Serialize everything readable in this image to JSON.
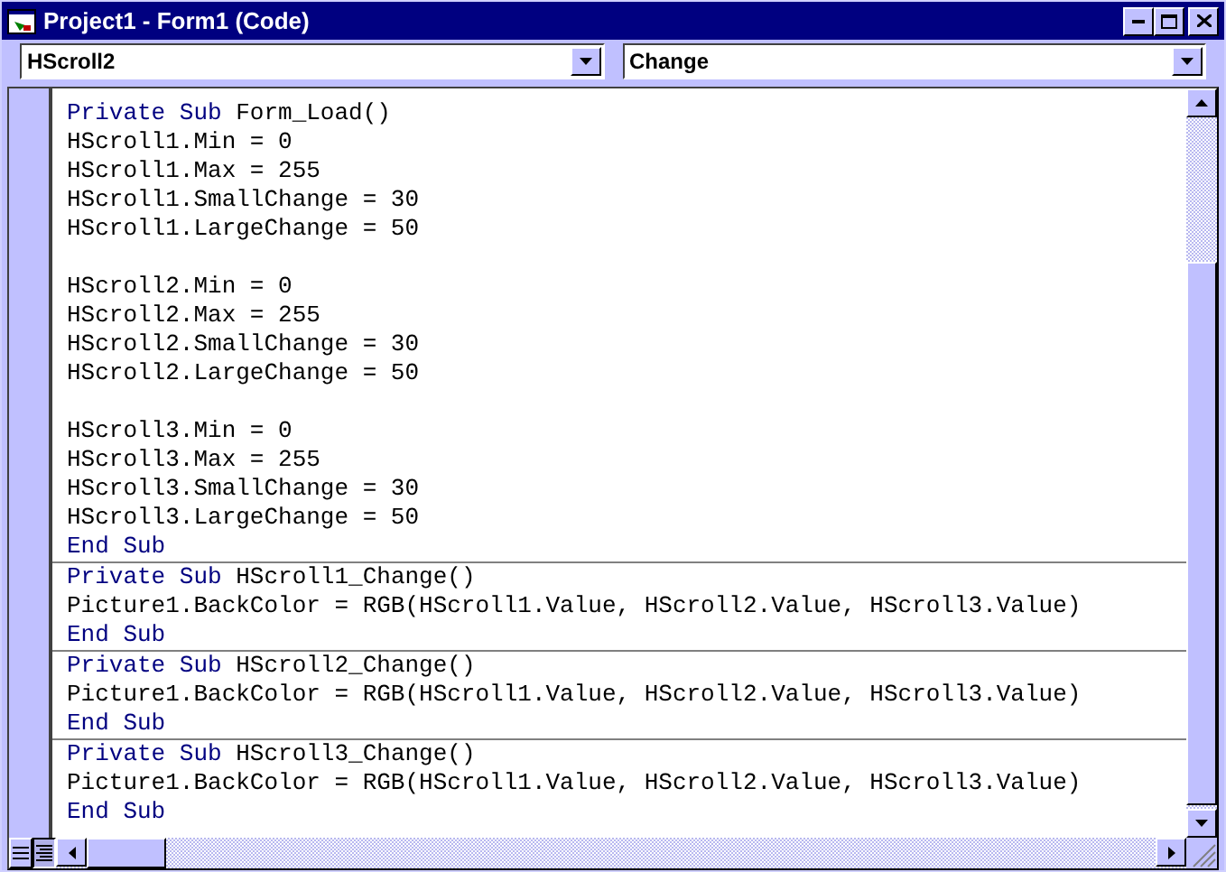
{
  "window": {
    "title": "Project1 - Form1 (Code)"
  },
  "object_combo": {
    "value": "HScroll2"
  },
  "procedure_combo": {
    "value": "Change"
  },
  "procedures": [
    {
      "lines": [
        [
          {
            "kind": "keyword",
            "text": "Private Sub"
          },
          {
            "kind": "plain",
            "text": " Form_Load()"
          }
        ],
        [
          {
            "kind": "plain",
            "text": "HScroll1.Min = 0"
          }
        ],
        [
          {
            "kind": "plain",
            "text": "HScroll1.Max = 255"
          }
        ],
        [
          {
            "kind": "plain",
            "text": "HScroll1.SmallChange = 30"
          }
        ],
        [
          {
            "kind": "plain",
            "text": "HScroll1.LargeChange = 50"
          }
        ],
        [
          {
            "kind": "blank"
          }
        ],
        [
          {
            "kind": "plain",
            "text": "HScroll2.Min = 0"
          }
        ],
        [
          {
            "kind": "plain",
            "text": "HScroll2.Max = 255"
          }
        ],
        [
          {
            "kind": "plain",
            "text": "HScroll2.SmallChange = 30"
          }
        ],
        [
          {
            "kind": "plain",
            "text": "HScroll2.LargeChange = 50"
          }
        ],
        [
          {
            "kind": "blank"
          }
        ],
        [
          {
            "kind": "plain",
            "text": "HScroll3.Min = 0"
          }
        ],
        [
          {
            "kind": "plain",
            "text": "HScroll3.Max = 255"
          }
        ],
        [
          {
            "kind": "plain",
            "text": "HScroll3.SmallChange = 30"
          }
        ],
        [
          {
            "kind": "plain",
            "text": "HScroll3.LargeChange = 50"
          }
        ],
        [
          {
            "kind": "keyword",
            "text": "End Sub"
          }
        ]
      ]
    },
    {
      "lines": [
        [
          {
            "kind": "keyword",
            "text": "Private Sub"
          },
          {
            "kind": "plain",
            "text": " HScroll1_Change()"
          }
        ],
        [
          {
            "kind": "plain",
            "text": "Picture1.BackColor = RGB(HScroll1.Value, HScroll2.Value, HScroll3.Value)"
          }
        ],
        [
          {
            "kind": "keyword",
            "text": "End Sub"
          }
        ]
      ]
    },
    {
      "lines": [
        [
          {
            "kind": "keyword",
            "text": "Private Sub"
          },
          {
            "kind": "plain",
            "text": " HScroll2_Change()"
          }
        ],
        [
          {
            "kind": "plain",
            "text": "Picture1.BackColor = RGB(HScroll1.Value, HScroll2.Value, HScroll3.Value)"
          }
        ],
        [
          {
            "kind": "keyword",
            "text": "End Sub"
          }
        ]
      ]
    },
    {
      "lines": [
        [
          {
            "kind": "keyword",
            "text": "Private Sub"
          },
          {
            "kind": "plain",
            "text": " HScroll3_Change()"
          }
        ],
        [
          {
            "kind": "plain",
            "text": "Picture1.BackColor = RGB(HScroll1.Value, HScroll2.Value, HScroll3.Value)"
          }
        ],
        [
          {
            "kind": "keyword",
            "text": "End Sub"
          }
        ]
      ]
    }
  ]
}
